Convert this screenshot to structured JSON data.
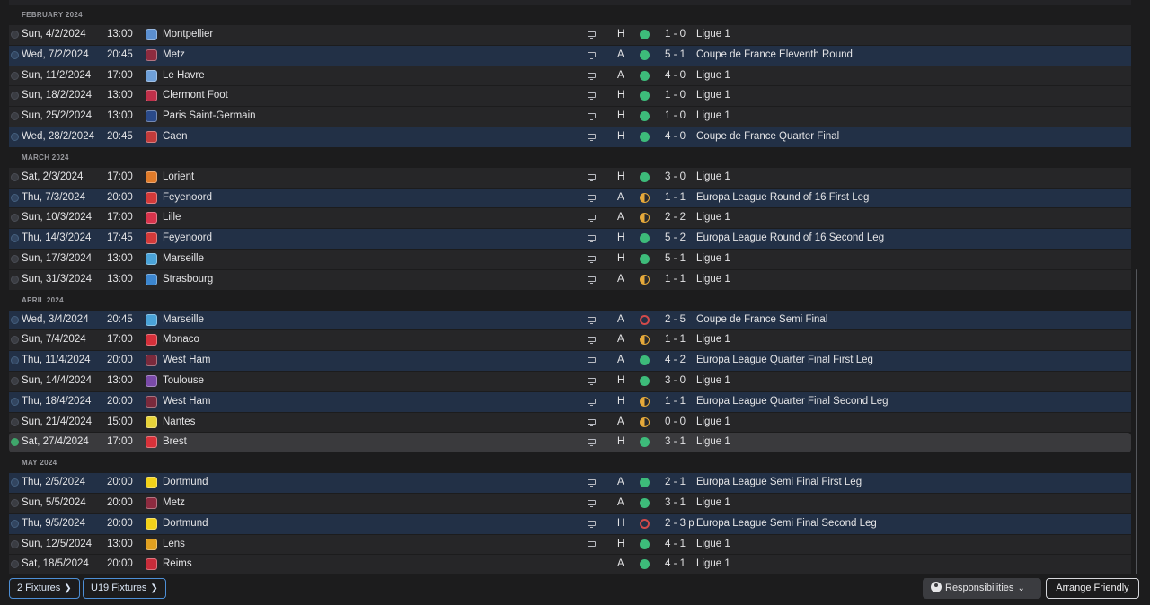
{
  "months": [
    {
      "label": "FEBRUARY 2024",
      "fixtures": [
        {
          "date": "Sun, 4/2/2024",
          "time": "13:00",
          "opponent": "Montpellier",
          "venue": "H",
          "result": "W",
          "score": "1 - 0",
          "competition": "Ligue 1",
          "cup": false,
          "tv": true,
          "selected": false,
          "crest_color": "#5b8fd0"
        },
        {
          "date": "Wed, 7/2/2024",
          "time": "20:45",
          "opponent": "Metz",
          "venue": "A",
          "result": "W",
          "score": "5 - 1",
          "competition": "Coupe de France Eleventh Round",
          "cup": true,
          "tv": true,
          "selected": false,
          "crest_color": "#8d2b3f"
        },
        {
          "date": "Sun, 11/2/2024",
          "time": "17:00",
          "opponent": "Le Havre",
          "venue": "A",
          "result": "W",
          "score": "4 - 0",
          "competition": "Ligue 1",
          "cup": false,
          "tv": true,
          "selected": false,
          "crest_color": "#6fa0d8"
        },
        {
          "date": "Sun, 18/2/2024",
          "time": "13:00",
          "opponent": "Clermont Foot",
          "venue": "H",
          "result": "W",
          "score": "1 - 0",
          "competition": "Ligue 1",
          "cup": false,
          "tv": true,
          "selected": false,
          "crest_color": "#c0304a"
        },
        {
          "date": "Sun, 25/2/2024",
          "time": "13:00",
          "opponent": "Paris Saint-Germain",
          "venue": "H",
          "result": "W",
          "score": "1 - 0",
          "competition": "Ligue 1",
          "cup": false,
          "tv": true,
          "selected": false,
          "crest_color": "#2a4a8a"
        },
        {
          "date": "Wed, 28/2/2024",
          "time": "20:45",
          "opponent": "Caen",
          "venue": "H",
          "result": "W",
          "score": "4 - 0",
          "competition": "Coupe de France Quarter Final",
          "cup": true,
          "tv": true,
          "selected": false,
          "crest_color": "#c23b3b"
        }
      ]
    },
    {
      "label": "MARCH 2024",
      "fixtures": [
        {
          "date": "Sat, 2/3/2024",
          "time": "17:00",
          "opponent": "Lorient",
          "venue": "H",
          "result": "W",
          "score": "3 - 0",
          "competition": "Ligue 1",
          "cup": false,
          "tv": true,
          "selected": false,
          "crest_color": "#e07b2a"
        },
        {
          "date": "Thu, 7/3/2024",
          "time": "20:00",
          "opponent": "Feyenoord",
          "venue": "A",
          "result": "D",
          "score": "1 - 1",
          "competition": "Europa League Round of 16  First Leg",
          "cup": true,
          "tv": true,
          "selected": false,
          "crest_color": "#d33a3a"
        },
        {
          "date": "Sun, 10/3/2024",
          "time": "17:00",
          "opponent": "Lille",
          "venue": "A",
          "result": "D",
          "score": "2 - 2",
          "competition": "Ligue 1",
          "cup": false,
          "tv": true,
          "selected": false,
          "crest_color": "#d8344c"
        },
        {
          "date": "Thu, 14/3/2024",
          "time": "17:45",
          "opponent": "Feyenoord",
          "venue": "H",
          "result": "W",
          "score": "5 - 2",
          "competition": "Europa League Round of 16  Second Leg",
          "cup": true,
          "tv": true,
          "selected": false,
          "crest_color": "#d33a3a"
        },
        {
          "date": "Sun, 17/3/2024",
          "time": "13:00",
          "opponent": "Marseille",
          "venue": "H",
          "result": "W",
          "score": "5 - 1",
          "competition": "Ligue 1",
          "cup": false,
          "tv": true,
          "selected": false,
          "crest_color": "#4aa3d8"
        },
        {
          "date": "Sun, 31/3/2024",
          "time": "13:00",
          "opponent": "Strasbourg",
          "venue": "A",
          "result": "D",
          "score": "1 - 1",
          "competition": "Ligue 1",
          "cup": false,
          "tv": true,
          "selected": false,
          "crest_color": "#3c86cf"
        }
      ]
    },
    {
      "label": "APRIL 2024",
      "fixtures": [
        {
          "date": "Wed, 3/4/2024",
          "time": "20:45",
          "opponent": "Marseille",
          "venue": "A",
          "result": "L",
          "score": "2 - 5",
          "competition": "Coupe de France Semi Final",
          "cup": true,
          "tv": true,
          "selected": false,
          "crest_color": "#4aa3d8"
        },
        {
          "date": "Sun, 7/4/2024",
          "time": "17:00",
          "opponent": "Monaco",
          "venue": "A",
          "result": "D",
          "score": "1 - 1",
          "competition": "Ligue 1",
          "cup": false,
          "tv": true,
          "selected": false,
          "crest_color": "#d6303a"
        },
        {
          "date": "Thu, 11/4/2024",
          "time": "20:00",
          "opponent": "West Ham",
          "venue": "A",
          "result": "W",
          "score": "4 - 2",
          "competition": "Europa League Quarter Final First Leg",
          "cup": true,
          "tv": true,
          "selected": false,
          "crest_color": "#7a2a3c"
        },
        {
          "date": "Sun, 14/4/2024",
          "time": "13:00",
          "opponent": "Toulouse",
          "venue": "H",
          "result": "W",
          "score": "3 - 0",
          "competition": "Ligue 1",
          "cup": false,
          "tv": true,
          "selected": false,
          "crest_color": "#7a4aa8"
        },
        {
          "date": "Thu, 18/4/2024",
          "time": "20:00",
          "opponent": "West Ham",
          "venue": "H",
          "result": "D",
          "score": "1 - 1",
          "competition": "Europa League Quarter Final Second Leg",
          "cup": true,
          "tv": true,
          "selected": false,
          "crest_color": "#7a2a3c"
        },
        {
          "date": "Sun, 21/4/2024",
          "time": "15:00",
          "opponent": "Nantes",
          "venue": "A",
          "result": "D",
          "score": "0 - 0",
          "competition": "Ligue 1",
          "cup": false,
          "tv": true,
          "selected": false,
          "crest_color": "#e6d23a"
        },
        {
          "date": "Sat, 27/4/2024",
          "time": "17:00",
          "opponent": "Brest",
          "venue": "H",
          "result": "W",
          "score": "3 - 1",
          "competition": "Ligue 1",
          "cup": false,
          "tv": true,
          "selected": true,
          "crest_color": "#d8323a"
        }
      ]
    },
    {
      "label": "MAY 2024",
      "fixtures": [
        {
          "date": "Thu, 2/5/2024",
          "time": "20:00",
          "opponent": "Dortmund",
          "venue": "A",
          "result": "W",
          "score": "2 - 1",
          "competition": "Europa League Semi Final First Leg",
          "cup": true,
          "tv": true,
          "selected": false,
          "crest_color": "#f2d21a"
        },
        {
          "date": "Sun, 5/5/2024",
          "time": "20:00",
          "opponent": "Metz",
          "venue": "A",
          "result": "W",
          "score": "3 - 1",
          "competition": "Ligue 1",
          "cup": false,
          "tv": true,
          "selected": false,
          "crest_color": "#8d2b3f"
        },
        {
          "date": "Thu, 9/5/2024",
          "time": "20:00",
          "opponent": "Dortmund",
          "venue": "H",
          "result": "L",
          "score": "2 - 3 p",
          "competition": "Europa League Semi Final Second Leg",
          "cup": true,
          "tv": true,
          "selected": false,
          "crest_color": "#f2d21a"
        },
        {
          "date": "Sun, 12/5/2024",
          "time": "13:00",
          "opponent": "Lens",
          "venue": "H",
          "result": "W",
          "score": "4 - 1",
          "competition": "Ligue 1",
          "cup": false,
          "tv": true,
          "selected": false,
          "crest_color": "#e0a020"
        },
        {
          "date": "Sat, 18/5/2024",
          "time": "20:00",
          "opponent": "Reims",
          "venue": "A",
          "result": "W",
          "score": "4 - 1",
          "competition": "Ligue 1",
          "cup": false,
          "tv": false,
          "selected": false,
          "crest_color": "#c82c3a"
        }
      ]
    }
  ],
  "footer": {
    "fixtures_button": "2 Fixtures",
    "u19_button": "U19 Fixtures",
    "responsibilities": "Responsibilities",
    "arrange_friendly": "Arrange Friendly"
  }
}
